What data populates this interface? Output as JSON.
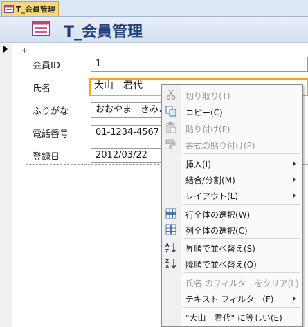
{
  "tab": {
    "title": "T_会員管理"
  },
  "form": {
    "title": "T_会員管理"
  },
  "fields": [
    {
      "label": "会員ID",
      "value": "1"
    },
    {
      "label": "氏名",
      "value": "大山　君代"
    },
    {
      "label": "ふりがな",
      "value": "おおやま　きみよ"
    },
    {
      "label": "電話番号",
      "value": "01-1234-4567"
    },
    {
      "label": "登録日",
      "value": "2012/03/22"
    }
  ],
  "context_menu": {
    "items": [
      {
        "label": "切り取り(T)",
        "icon": "scissors-icon",
        "disabled": true
      },
      {
        "label": "コピー(C)",
        "icon": "copy-icon",
        "disabled": false
      },
      {
        "label": "貼り付け(P)",
        "icon": "paste-icon",
        "disabled": true
      },
      {
        "label": "書式の貼り付け(P)",
        "icon": "format-painter-icon",
        "disabled": true
      },
      {
        "label": "挿入(I)",
        "submenu": true
      },
      {
        "label": "結合/分割(M)",
        "submenu": true
      },
      {
        "label": "レイアウト(L)",
        "submenu": true
      },
      {
        "label": "行全体の選択(W)",
        "icon": "select-row-icon"
      },
      {
        "label": "列全体の選択(C)",
        "icon": "select-column-icon"
      },
      {
        "label": "昇順で並べ替え(S)",
        "icon": "sort-ascending-icon"
      },
      {
        "label": "降順で並べ替え(O)",
        "icon": "sort-descending-icon"
      },
      {
        "label": "氏名 のフィルターをクリア(L)",
        "disabled": true
      },
      {
        "label": "テキスト フィルター(F)",
        "submenu": true
      },
      {
        "label": "\"大山　君代\" に等しい(E)"
      }
    ]
  },
  "colors": {
    "accent": "#f5a623",
    "title": "#1e3f78",
    "tab_active": "#f6d979"
  }
}
